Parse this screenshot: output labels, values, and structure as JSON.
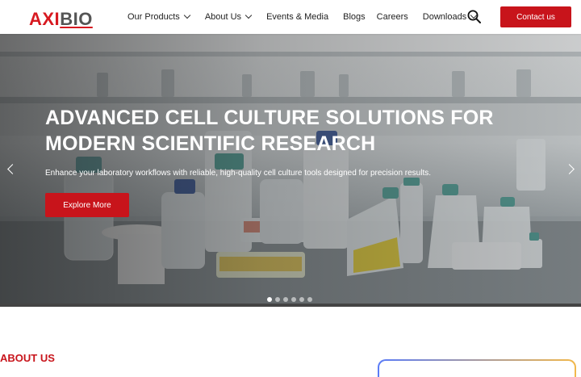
{
  "brand": {
    "logo_left": "AXI",
    "logo_right": "BIO",
    "accent": "#c8141b"
  },
  "nav": {
    "items": [
      {
        "label": "Our Products",
        "has_dropdown": true
      },
      {
        "label": "About Us",
        "has_dropdown": true
      },
      {
        "label": "Events & Media",
        "has_dropdown": false
      },
      {
        "label": "Blogs",
        "has_dropdown": false
      },
      {
        "label": "Careers",
        "has_dropdown": false
      },
      {
        "label": "Downloads",
        "has_dropdown": true
      }
    ],
    "search_icon": "search-icon",
    "contact_label": "Contact us"
  },
  "hero": {
    "title": "ADVANCED CELL CULTURE SOLUTIONS FOR MODERN SCIENTIFIC RESEARCH",
    "subtitle": "Enhance your laboratory workflows with reliable, high-quality cell culture tools designed for precision results.",
    "cta_label": "Explore More",
    "slides": 6,
    "active_slide": 1
  },
  "about": {
    "heading": "ABOUT US"
  }
}
